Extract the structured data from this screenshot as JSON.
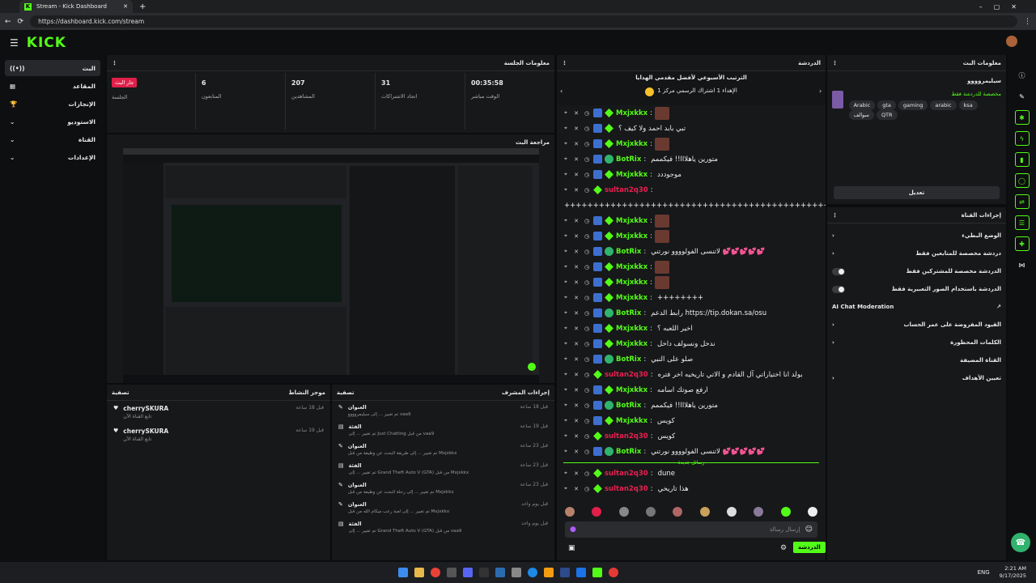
{
  "browser": {
    "tab_title": "Stream - Kick Dashboard",
    "url": "https://dashboard.kick.com/stream"
  },
  "topbar": {
    "logo": "KICK"
  },
  "nav": {
    "items": [
      {
        "label": "البث",
        "icon": "live-icon"
      },
      {
        "label": "المقاعد",
        "icon": "seat-icon"
      },
      {
        "label": "الإنجازات",
        "icon": "trophy-icon"
      },
      {
        "label": "الاستوديو",
        "icon": "studio-icon"
      },
      {
        "label": "القناة",
        "icon": "channel-icon"
      },
      {
        "label": "الإعدادات",
        "icon": "settings-icon"
      }
    ]
  },
  "session": {
    "title": "معلومات الجلسة",
    "stats": [
      {
        "value": "جار البث",
        "label": "الجلسة"
      },
      {
        "value": "6",
        "label": "المتابعون"
      },
      {
        "value": "207",
        "label": "المشاهدين"
      },
      {
        "value": "31",
        "label": "اتحاد الاشتراكات"
      },
      {
        "value": "00:35:58",
        "label": "الوقت مباشر"
      }
    ]
  },
  "preview": {
    "title": "مراجعة البث"
  },
  "activity": {
    "title": "موجز النشاط",
    "filter": "تصفية",
    "items": [
      {
        "name": "cherrySKURA",
        "sub": "تابع القناة الآن",
        "time": "قبل 18 ساعة"
      },
      {
        "name": "cherrySKURA",
        "sub": "تابع القناة الآن",
        "time": "قبل 19 ساعة"
      }
    ]
  },
  "modactions": {
    "title": "إجراءات المشرف",
    "filter": "تصفية",
    "items": [
      {
        "title": "العنوان",
        "desc": "تم تغيير ... إلى سيليمروووو vaa9",
        "time": "قبل 18 ساعة"
      },
      {
        "title": "الفئة",
        "desc": "تم تغيير ... إلى Just Chatting من قبل vaa9",
        "time": "قبل 19 ساعة"
      },
      {
        "title": "العنوان",
        "desc": "تم تغيير ... إلى طريقة البحث عن وظيفة من قبل Mxjxkkx",
        "time": "قبل 23 ساعة"
      },
      {
        "title": "الفئة",
        "desc": "تم تغيير ... إلى Grand Theft Auto V (GTA) من قبل Mxjxkkx",
        "time": "قبل 23 ساعة"
      },
      {
        "title": "العنوان",
        "desc": "تم تغيير ... إلى رحلة البحث عن وظيفة من قبل Mxjxkkx",
        "time": "قبل 23 ساعة"
      },
      {
        "title": "العنوان",
        "desc": "تم تغيير ... إلى لعبة رعب ميكام الله من قبل Mxjxkkx",
        "time": "قبل يوم واحد"
      },
      {
        "title": "الفئة",
        "desc": "تم تغيير ... إلى Grand Theft Auto V (GTA) من قبل vaa9",
        "time": "قبل يوم واحد"
      }
    ]
  },
  "chat": {
    "title": "الدردشة",
    "pinned_title": "الترتيب الأسبوعي لأفضل مقدمي الهدايا",
    "pinned_entry": "الإهداء 1 اشتراك الرسمي مركز 1",
    "lines": [
      {
        "user": "Mxjxkkx",
        "text": "",
        "emote": true,
        "badge": "blue",
        "red": false
      },
      {
        "user": "",
        "text": "تبي بابد احمد ولا كيف ؟",
        "emote": false,
        "badge": "blue",
        "red": false
      },
      {
        "user": "Mxjxkkx",
        "text": "",
        "emote": true,
        "badge": "blue",
        "red": false
      },
      {
        "user": "BotRix",
        "text": "متورين ياهلااا!! فيكممم",
        "emote": false,
        "badge": "bot",
        "red": false
      },
      {
        "user": "Mxjxkkx",
        "text": "موجوددد",
        "emote": false,
        "badge": "blue",
        "red": false
      },
      {
        "user": "sultan2q30",
        "text": "",
        "emote": false,
        "badge": "green",
        "red": true
      },
      {
        "user": "",
        "text": "++++++++++++++++++++++++++++++++++++++++++++++++++++++++++++++++++++++",
        "emote": false,
        "badge": "none",
        "red": false
      },
      {
        "user": "Mxjxkkx",
        "text": "",
        "emote": true,
        "badge": "blue",
        "red": false
      },
      {
        "user": "Mxjxkkx",
        "text": "",
        "emote": true,
        "badge": "blue",
        "red": false
      },
      {
        "user": "BotRix",
        "text": "لاتنسى الفولوووو نورتني 💕💕💕💕💕",
        "emote": false,
        "badge": "bot",
        "red": false
      },
      {
        "user": "Mxjxkkx",
        "text": "",
        "emote": true,
        "badge": "blue",
        "red": false
      },
      {
        "user": "Mxjxkkx",
        "text": "",
        "emote": true,
        "badge": "blue",
        "red": false
      },
      {
        "user": "Mxjxkkx",
        "text": "++++++++",
        "emote": false,
        "badge": "blue",
        "red": false
      },
      {
        "user": "BotRix",
        "text": "رابط الدعم https://tip.dokan.sa/osu",
        "emote": false,
        "badge": "bot",
        "red": false
      },
      {
        "user": "Mxjxkkx",
        "text": "اخير اللعبه ؟",
        "emote": false,
        "badge": "blue",
        "red": false
      },
      {
        "user": "Mxjxkkx",
        "text": "ندخل ونسولف داخل",
        "emote": false,
        "badge": "blue",
        "red": false
      },
      {
        "user": "BotRix",
        "text": "صلو على النبي",
        "emote": false,
        "badge": "bot",
        "red": false
      },
      {
        "user": "sultan2q30",
        "text": "بولد انا اختياراتي آل القادم و الاتي تاريخيه اخر فتره",
        "emote": false,
        "badge": "green",
        "red": true
      },
      {
        "user": "Mxjxkkx",
        "text": "ارفع صوتك اسامه",
        "emote": false,
        "badge": "blue",
        "red": false
      },
      {
        "user": "BotRix",
        "text": "متورين ياهلااا!! فيكممم",
        "emote": false,
        "badge": "bot",
        "red": false
      },
      {
        "user": "Mxjxkkx",
        "text": "كويس",
        "emote": false,
        "badge": "blue",
        "red": false
      },
      {
        "user": "sultan2q30",
        "text": "كويس",
        "emote": false,
        "badge": "green",
        "red": true
      },
      {
        "user": "BotRix",
        "text": "لاتنسى الفولوووو نورتني 💕💕💕💕💕",
        "emote": false,
        "badge": "bot",
        "red": false
      }
    ],
    "new_messages": "رسائل جديدة",
    "after_lines": [
      {
        "user": "sultan2q30",
        "text": "dune"
      },
      {
        "user": "sultan2q30",
        "text": "هذا تاريخي"
      }
    ],
    "input_placeholder": "إرسال رسالة",
    "send_label": "الدردشة"
  },
  "streaminfo": {
    "title": "معلومات البث",
    "channel_name": "سيليمروووو",
    "category": "مخصصة للدردشة فقط",
    "tags": [
      "Arabic",
      "gta",
      "gaming",
      "arabic",
      "ksa",
      "سوالف",
      "QTR"
    ],
    "edit_label": "تعديل"
  },
  "channel_actions": {
    "title": "إجراءات القناة",
    "rows": [
      {
        "label": "الوضع البطيء",
        "control": "arrow"
      },
      {
        "label": "دردشة مخصصة للمتابعين فقط",
        "control": "arrow"
      },
      {
        "label": "الدردشة مخصصة للمشتركين فقط",
        "control": "toggle"
      },
      {
        "label": "الدردشة باستخدام الصور التعبيرية فقط",
        "control": "toggle"
      },
      {
        "label": "AI Chat Moderation",
        "control": "external"
      },
      {
        "label": "القيود المفروضة على عمر الحساب",
        "control": "arrow"
      },
      {
        "label": "الكلمات المحظورة",
        "control": "arrow"
      },
      {
        "label": "القناة المضيفة",
        "control": "none"
      },
      {
        "label": "تعيين الأهداف",
        "control": "arrow"
      }
    ]
  },
  "taskbar": {
    "lang": "ENG",
    "time": "2:21 AM",
    "date": "9/17/2025"
  },
  "colors": {
    "accent": "#53fc18",
    "live": "#e0204a",
    "panel": "#17181a"
  }
}
